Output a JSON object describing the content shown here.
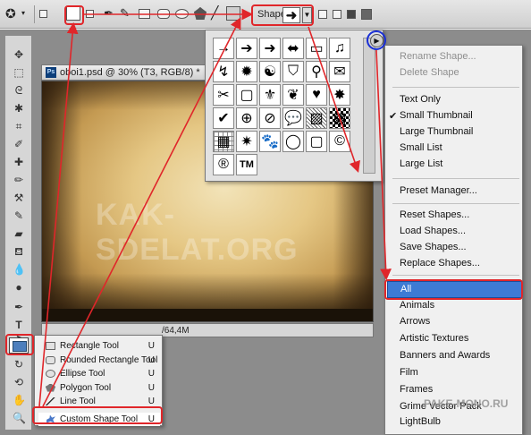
{
  "options_bar": {
    "shape_label": "Shape:",
    "shape_value": "➜"
  },
  "document": {
    "ps_badge": "Ps",
    "tab_title": "oboi1.psd @ 30% (T3, RGB/8) *",
    "watermark": "KAK-SDELAT.ORG",
    "status": "/64,4M"
  },
  "shape_picker": {
    "menu_button_icon": "circle-arrow-right-icon",
    "shapes": [
      "→",
      "➔",
      "➜",
      "⬌",
      "▭",
      "♫",
      "↯",
      "✹",
      "☯",
      "⛉",
      "⚲",
      "✉",
      "✂",
      "▢",
      "⚜",
      "❦",
      "♥",
      "✸",
      "✔",
      "⊕",
      "⊘",
      "💬",
      "▨",
      "▩",
      "▦",
      "✷",
      "🐾",
      "◯",
      "▢",
      "©",
      "®",
      "TM"
    ]
  },
  "flyout_menu": {
    "items": [
      {
        "label": "Rename Shape...",
        "disabled": true
      },
      {
        "label": "Delete Shape",
        "disabled": true
      },
      {
        "label": "Text Only"
      },
      {
        "label": "Small Thumbnail",
        "checked": true
      },
      {
        "label": "Large Thumbnail"
      },
      {
        "label": "Small List"
      },
      {
        "label": "Large List"
      },
      {
        "label": "Preset Manager..."
      },
      {
        "label": "Reset Shapes..."
      },
      {
        "label": "Load Shapes..."
      },
      {
        "label": "Save Shapes..."
      },
      {
        "label": "Replace Shapes..."
      },
      {
        "label": "All",
        "selected": true
      },
      {
        "label": "Animals"
      },
      {
        "label": "Arrows"
      },
      {
        "label": "Artistic Textures"
      },
      {
        "label": "Banners and Awards"
      },
      {
        "label": "Film"
      },
      {
        "label": "Frames"
      },
      {
        "label": "Grime Vector Pack"
      },
      {
        "label": "LightBulb"
      }
    ]
  },
  "tool_flyout": {
    "items": [
      {
        "label": "Rectangle Tool",
        "key": "U"
      },
      {
        "label": "Rounded Rectangle Tool",
        "key": "U"
      },
      {
        "label": "Ellipse Tool",
        "key": "U"
      },
      {
        "label": "Polygon Tool",
        "key": "U"
      },
      {
        "label": "Line Tool",
        "key": "U"
      },
      {
        "label": "Custom Shape Tool",
        "key": "U"
      }
    ]
  },
  "site_watermark": "PAKE-MONO.RU",
  "colors": {
    "annotation_red": "#e0262a",
    "annotation_blue": "#1a2fd6",
    "selection_blue": "#3d7bd4"
  }
}
